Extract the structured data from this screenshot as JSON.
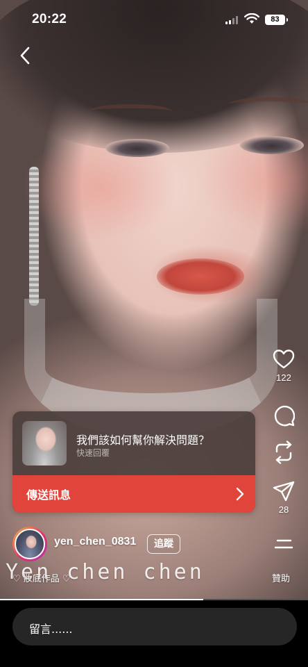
{
  "status_bar": {
    "time": "20:22",
    "battery": "83"
  },
  "post": {
    "likes": "122",
    "shares": "28",
    "username": "yen_chen_0831",
    "follow_label": "追蹤",
    "caption": "♡ 妝底作品 ♡",
    "watermark": "Yen chen chen",
    "sponsor_label": "贊助",
    "progress": 0.66
  },
  "reply_card": {
    "question": "我們該如何幫你解決問題？",
    "subtitle": "快速回覆",
    "send_label": "傳送訊息"
  },
  "comment_bar": {
    "placeholder": "留言......"
  },
  "icons": {
    "back": "chevron-left-icon",
    "like": "heart-icon",
    "comment": "speech-bubble-icon",
    "remix": "repost-icon",
    "share": "paper-plane-icon",
    "more": "menu-icon"
  },
  "colors": {
    "accent_red": "#e0443a",
    "card_bg": "#4b3e3c",
    "comment_bg": "#262626"
  }
}
